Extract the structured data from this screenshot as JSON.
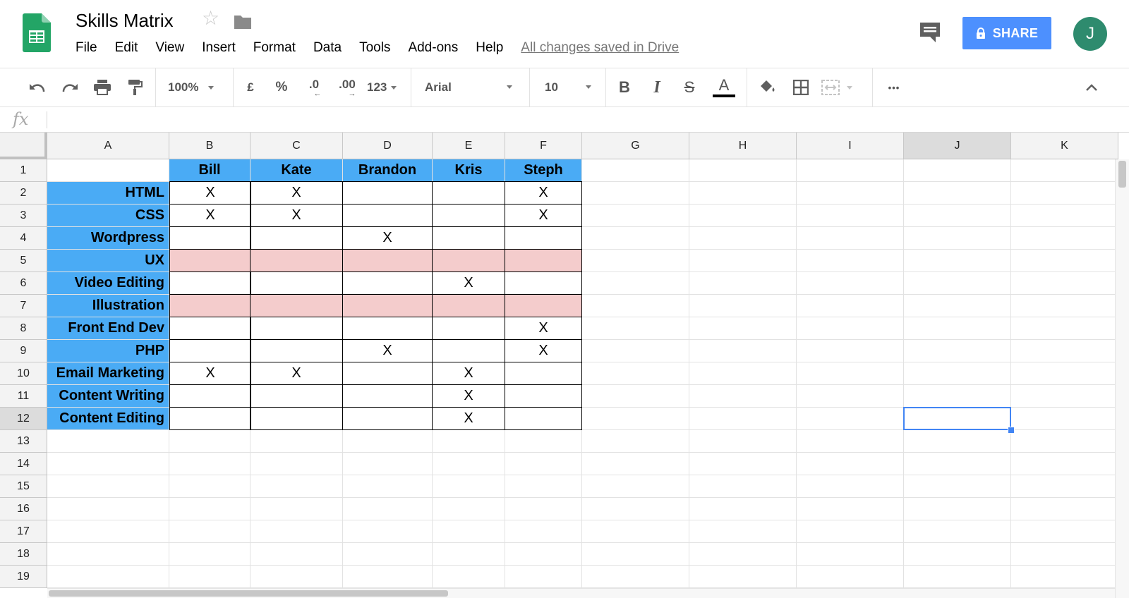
{
  "header": {
    "title": "Skills Matrix",
    "menu": [
      "File",
      "Edit",
      "View",
      "Insert",
      "Format",
      "Data",
      "Tools",
      "Add-ons",
      "Help"
    ],
    "save_status": "All changes saved in Drive",
    "share_label": "SHARE",
    "avatar_letter": "J"
  },
  "toolbar": {
    "zoom": "100%",
    "currency": "£",
    "percent": "%",
    "decrease_decimal": ".0",
    "increase_decimal": ".00",
    "more_formats": "123",
    "font": "Arial",
    "font_size": "10",
    "bold": "B",
    "italic": "I",
    "strikethrough": "S",
    "text_color_glyph": "A",
    "more": "•••"
  },
  "formula_bar": {
    "fx_label": "fx",
    "value": ""
  },
  "sheet": {
    "columns": [
      "A",
      "B",
      "C",
      "D",
      "E",
      "F",
      "G",
      "H",
      "I",
      "J",
      "K"
    ],
    "rows": [
      "1",
      "2",
      "3",
      "4",
      "5",
      "6",
      "7",
      "8",
      "9",
      "10",
      "11",
      "12",
      "13",
      "14",
      "15",
      "16",
      "17",
      "18",
      "19"
    ],
    "selected_cell": "J12",
    "colors": {
      "header_fill": "#4aabf5",
      "highlight_fill": "#f4cccc",
      "selection": "#4285f4"
    },
    "people": [
      "Bill",
      "Kate",
      "Brandon",
      "Kris",
      "Steph"
    ],
    "skills": [
      {
        "name": "HTML",
        "marks": [
          "X",
          "X",
          "",
          "",
          "X"
        ],
        "highlight": false
      },
      {
        "name": "CSS",
        "marks": [
          "X",
          "X",
          "",
          "",
          "X"
        ],
        "highlight": false
      },
      {
        "name": "Wordpress",
        "marks": [
          "",
          "",
          "X",
          "",
          ""
        ],
        "highlight": false
      },
      {
        "name": "UX",
        "marks": [
          "",
          "",
          "",
          "",
          ""
        ],
        "highlight": true
      },
      {
        "name": "Video Editing",
        "marks": [
          "",
          "",
          "",
          "X",
          ""
        ],
        "highlight": false
      },
      {
        "name": "Illustration",
        "marks": [
          "",
          "",
          "",
          "",
          ""
        ],
        "highlight": true
      },
      {
        "name": "Front End Dev",
        "marks": [
          "",
          "",
          "",
          "",
          "X"
        ],
        "highlight": false
      },
      {
        "name": "PHP",
        "marks": [
          "",
          "",
          "X",
          "",
          "X"
        ],
        "highlight": false
      },
      {
        "name": "Email Marketing",
        "marks": [
          "X",
          "X",
          "",
          "X",
          ""
        ],
        "highlight": false
      },
      {
        "name": "Content Writing",
        "marks": [
          "",
          "",
          "",
          "X",
          ""
        ],
        "highlight": false
      },
      {
        "name": "Content Editing",
        "marks": [
          "",
          "",
          "",
          "X",
          ""
        ],
        "highlight": false
      }
    ]
  }
}
